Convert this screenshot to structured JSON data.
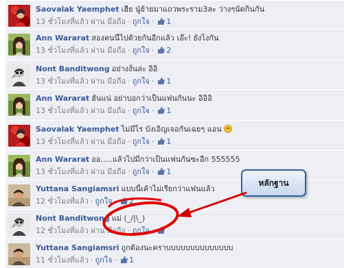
{
  "feed": {
    "comments": [
      {
        "author": "Saovalak Yaemphet",
        "text": "เฮีย นู๋ย้ายมาแถวพระราม3ละ ว่างๆนัดกินกัน",
        "emoji": false,
        "time": "13 ชั่วโมงที่แล้ว",
        "via": "ผ่าน มือถือ",
        "like_label": "ถูกใจ",
        "likes": "1",
        "mobile": true,
        "avatar": "avatar-red"
      },
      {
        "author": "Ann Wararat",
        "text": "สองคนนี้ไปด้วยกันอีกแล้ว เอ๊ะ! ยังไงกัน",
        "emoji": false,
        "time": "13 ชั่วโมงที่แล้ว",
        "via": "ผ่าน มือถือ",
        "like_label": "ถูกใจ",
        "likes": "2",
        "mobile": true,
        "avatar": "avatar-green"
      },
      {
        "author": "Nont Banditwong",
        "text": "อย่างงั้นล่ะ อิอิ",
        "emoji": false,
        "time": "13 ชั่วโมงที่แล้ว",
        "via": "ผ่าน มือถือ",
        "like_label": "ถูกใจ",
        "likes": "1",
        "mobile": true,
        "avatar": "avatar-bw"
      },
      {
        "author": "Ann Wararat",
        "text": "ฮั่นแน่ อย่าบอกว่าเป็นแฟนกันนะ อิอิอิ",
        "emoji": false,
        "time": "13 ชั่วโมงที่แล้ว",
        "via": "ผ่าน มือถือ",
        "like_label": "ถูกใจ",
        "likes": "1",
        "mobile": true,
        "avatar": "avatar-green"
      },
      {
        "author": "Saovalak Yaemphet",
        "text": "ไม่มีไร บังเอิญเจอกันเฉยๆ แอน",
        "emoji": true,
        "time": "13 ชั่วโมงที่แล้ว",
        "via": "ผ่าน มือถือ",
        "like_label": "ถูกใจ",
        "likes": "1",
        "mobile": true,
        "avatar": "avatar-red"
      },
      {
        "author": "Ann Wararat",
        "text": "ออ.....แล้วไปมีกว่าเป็นแฟนกันซะอีก 555555",
        "emoji": false,
        "time": "13 ชั่วโมงที่แล้ว",
        "via": "ผ่าน มือถือ",
        "like_label": "ถูกใจ",
        "likes": "1",
        "mobile": true,
        "avatar": "avatar-green"
      },
      {
        "author": "Yuttana Sangiamsri",
        "text": "แบบนี้เค้าไม่เรียกว่าแฟนแล้ว",
        "emoji": false,
        "time": "12 ชั่วโมงที่แล้ว",
        "via": "",
        "like_label": "ถูกใจ",
        "likes": "2",
        "mobile": false,
        "avatar": "avatar-tan"
      },
      {
        "author": "Nont Banditwong",
        "text": "แม่ (_/|\\_)",
        "emoji": false,
        "time": "12 ชั่วโมงที่แล้ว",
        "via": "ผ่าน มือถือ",
        "like_label": "ถูกใจ",
        "likes": "",
        "mobile": true,
        "avatar": "avatar-bw"
      },
      {
        "author": "Yuttana Sangiamsri",
        "text": "ถูกต้องนะคราบบบบบบบบบบบบบบ",
        "emoji": false,
        "time": "11 ชั่วโมงที่แล้ว",
        "via": "",
        "like_label": "ถูกใจ",
        "likes": "1",
        "mobile": false,
        "avatar": "avatar-tan"
      }
    ]
  },
  "annotation": {
    "callout_text": "หลักฐาน",
    "circle_color": "#e00000",
    "arrow_color": "#d00000"
  },
  "colors": {
    "link_blue": "#3b5998",
    "feed_bg": "#edeff4",
    "meta_gray": "#808080"
  }
}
